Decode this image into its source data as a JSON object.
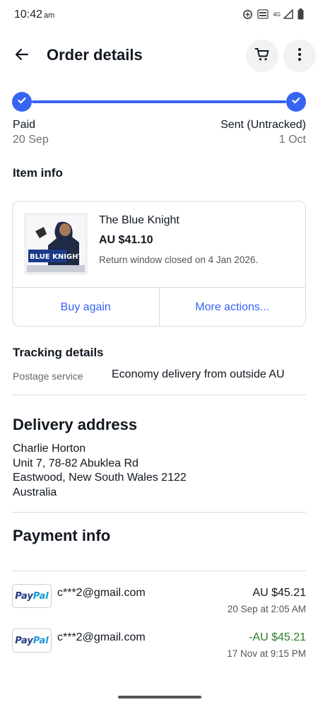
{
  "status_bar": {
    "time": "10:42",
    "ampm": "am",
    "network": "4G",
    "icons": [
      "data-saver-icon",
      "volte-icon",
      "signal-icon",
      "battery-icon"
    ]
  },
  "header": {
    "title": "Order details",
    "back_icon": "back-arrow-icon",
    "cart_icon": "cart-icon",
    "more_icon": "more-vertical-icon"
  },
  "progress": {
    "accent": "#3665f3",
    "stages": [
      {
        "name": "Paid",
        "date": "20 Sep"
      },
      {
        "name": "Sent (Untracked)",
        "date": "1 Oct"
      }
    ]
  },
  "item_info": {
    "heading": "Item info",
    "title": "The Blue Knight",
    "price": "AU $41.10",
    "return_note": "Return window closed on 4 Jan 2026.",
    "thumbnail_text": "BLUE KNIGHT",
    "buy_again": "Buy again",
    "more_actions": "More actions..."
  },
  "tracking": {
    "heading": "Tracking details",
    "label": "Postage service",
    "value": "Economy delivery from outside AU"
  },
  "delivery": {
    "heading": "Delivery address",
    "lines": [
      "Charlie Horton",
      "Unit 7, 78-82 Abuklea Rd",
      "Eastwood, New South Wales 2122",
      "Australia"
    ]
  },
  "payment": {
    "heading": "Payment info",
    "logo_text_1": "Pay",
    "logo_text_2": "Pal",
    "rows": [
      {
        "email": "c***2@gmail.com",
        "amount": "AU $45.21",
        "time": "20 Sep at 2:05 AM"
      },
      {
        "email": "c***2@gmail.com",
        "amount": "-AU $45.21",
        "time": "17 Nov at 9:15 PM"
      }
    ],
    "refund_color": "#2a7d2a"
  }
}
